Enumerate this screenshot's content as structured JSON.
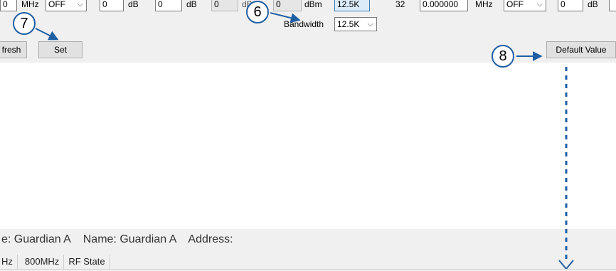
{
  "rf_row": {
    "freq_value_1": "0",
    "freq_unit_1": "MHz",
    "state_select_1": "OFF",
    "gain_value_1": "0",
    "gain_unit_1": "dB",
    "gain_value_2": "0",
    "gain_unit_2": "dB",
    "gain_value_3_disabled": "0",
    "gain_unit_3_partial": "dB",
    "power_value": "0",
    "power_unit": "dBm",
    "bandwidth_display": "12.5K",
    "channel_count": "32",
    "freq_value_2": "0.000000",
    "freq_unit_2": "MHz",
    "state_select_2": "OFF",
    "gain_value_4": "0",
    "gain_unit_4": "dB",
    "bandwidth_label": "Bandwidth",
    "bandwidth_select": "12.5K"
  },
  "buttons": {
    "refresh_partial": "fresh",
    "set": "Set",
    "default_value": "Default Value"
  },
  "callouts": {
    "c6": "6",
    "c7": "7",
    "c8": "8"
  },
  "device_info": {
    "type_partial": "e: Guardian A",
    "name_label": "Name:",
    "name_value": "Guardian A",
    "address_label": "Address:"
  },
  "tabs": [
    "Hz",
    "800MHz",
    "RF State"
  ],
  "icons": {
    "chevron": "chevron-down-icon",
    "arrow": "arrow-right-icon"
  },
  "colors": {
    "callout_blue": "#1f5ea3",
    "panel_grey": "#f0f0f0",
    "highlight_blue": "#dcecf9"
  }
}
